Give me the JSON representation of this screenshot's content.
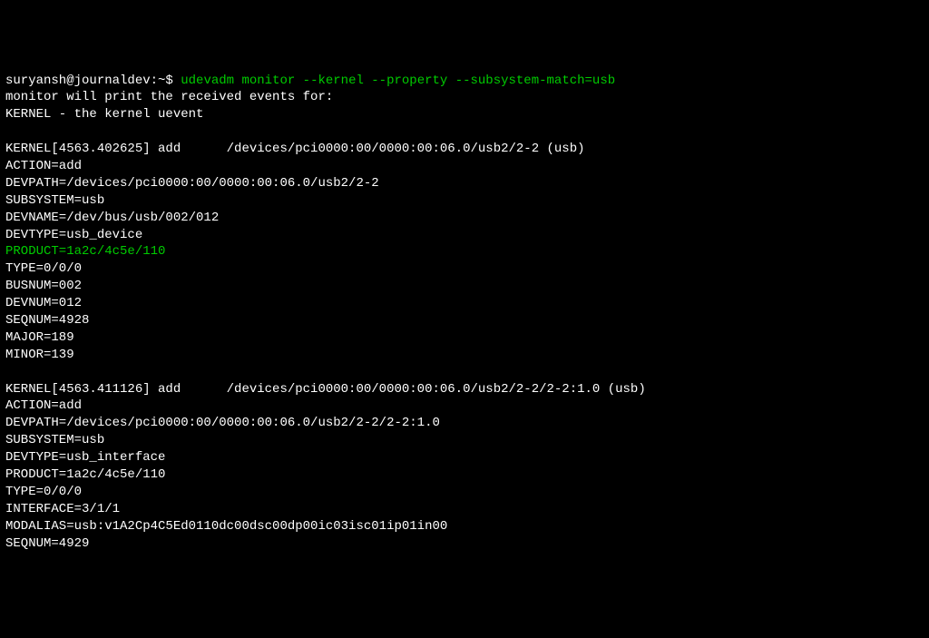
{
  "prompt": {
    "user_host": "suryansh@journaldev:~$",
    "command": "udevadm monitor --kernel --property --subsystem-match=usb"
  },
  "intro": {
    "line1": "monitor will print the received events for:",
    "line2": "KERNEL - the kernel uevent"
  },
  "event1": {
    "header": "KERNEL[4563.402625] add      /devices/pci0000:00/0000:00:06.0/usb2/2-2 (usb)",
    "ACTION": "ACTION=add",
    "DEVPATH": "DEVPATH=/devices/pci0000:00/0000:00:06.0/usb2/2-2",
    "SUBSYSTEM": "SUBSYSTEM=usb",
    "DEVNAME": "DEVNAME=/dev/bus/usb/002/012",
    "DEVTYPE": "DEVTYPE=usb_device",
    "PRODUCT": "PRODUCT=1a2c/4c5e/110",
    "TYPE": "TYPE=0/0/0",
    "BUSNUM": "BUSNUM=002",
    "DEVNUM": "DEVNUM=012",
    "SEQNUM": "SEQNUM=4928",
    "MAJOR": "MAJOR=189",
    "MINOR": "MINOR=139"
  },
  "event2": {
    "header": "KERNEL[4563.411126] add      /devices/pci0000:00/0000:00:06.0/usb2/2-2/2-2:1.0 (usb)",
    "ACTION": "ACTION=add",
    "DEVPATH": "DEVPATH=/devices/pci0000:00/0000:00:06.0/usb2/2-2/2-2:1.0",
    "SUBSYSTEM": "SUBSYSTEM=usb",
    "DEVTYPE": "DEVTYPE=usb_interface",
    "PRODUCT": "PRODUCT=1a2c/4c5e/110",
    "TYPE": "TYPE=0/0/0",
    "INTERFACE": "INTERFACE=3/1/1",
    "MODALIAS": "MODALIAS=usb:v1A2Cp4C5Ed0110dc00dsc00dp00ic03isc01ip01in00",
    "SEQNUM": "SEQNUM=4929"
  }
}
